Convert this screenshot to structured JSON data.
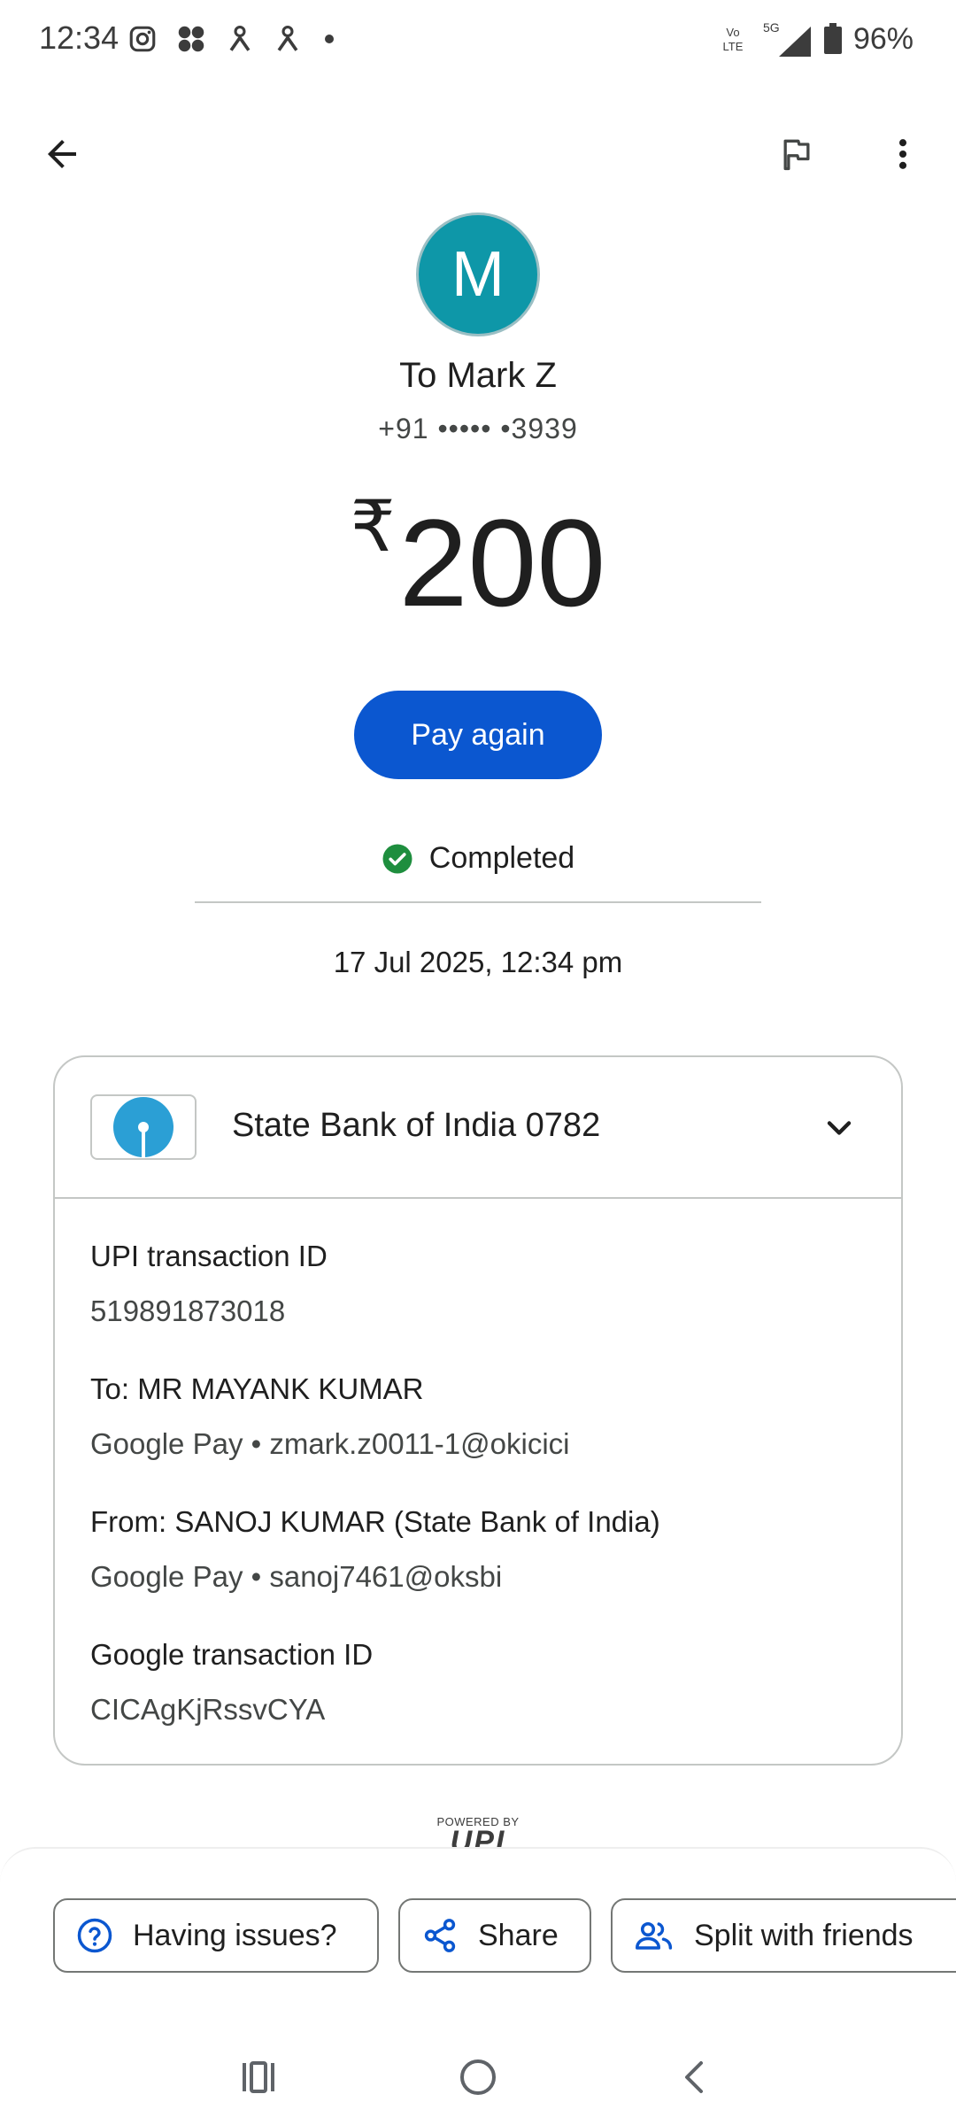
{
  "status_bar": {
    "time": "12:34",
    "battery": "96%",
    "network": "5G",
    "volte": "Vo LTE",
    "icons": [
      "instagram-icon",
      "app-icon",
      "person-icon",
      "person-icon",
      "dot-icon",
      "volte-icon",
      "signal-icon",
      "battery-icon"
    ]
  },
  "toolbar": {
    "back_icon": "arrow-back-icon",
    "flag_icon": "flag-icon",
    "more_icon": "more-vert-icon"
  },
  "recipient": {
    "avatar_letter": "M",
    "avatar_color": "#0e97a8",
    "name": "To Mark Z",
    "phone": "+91 ••••• •3939"
  },
  "payment": {
    "currency": "₹",
    "amount": "200",
    "pay_again_label": "Pay again",
    "status": "Completed",
    "status_color": "#1e8e3e",
    "datetime": "17 Jul 2025, 12:34 pm"
  },
  "card": {
    "bank_name": "State Bank of India 0782",
    "bank_logo_color": "#2b9fd5",
    "details": [
      {
        "label": "UPI transaction ID",
        "value": "519891873018"
      },
      {
        "label": "To: MR MAYANK  KUMAR",
        "value": "Google Pay • zmark.z0011-1@okicici"
      },
      {
        "label": "From: SANOJ  KUMAR (State Bank of India)",
        "value": "Google Pay • sanoj7461@oksbi"
      },
      {
        "label": "Google transaction ID",
        "value": "CICAgKjRssvCYA"
      }
    ]
  },
  "upi": {
    "powered_by": "POWERED BY",
    "mark": "UPI"
  },
  "actions": {
    "issues_label": "Having issues?",
    "share_label": "Share",
    "split_label": "Split with friends",
    "accent_color": "#0b57d0"
  },
  "nav": {
    "icons": [
      "recents-icon",
      "home-icon",
      "back-icon"
    ]
  }
}
